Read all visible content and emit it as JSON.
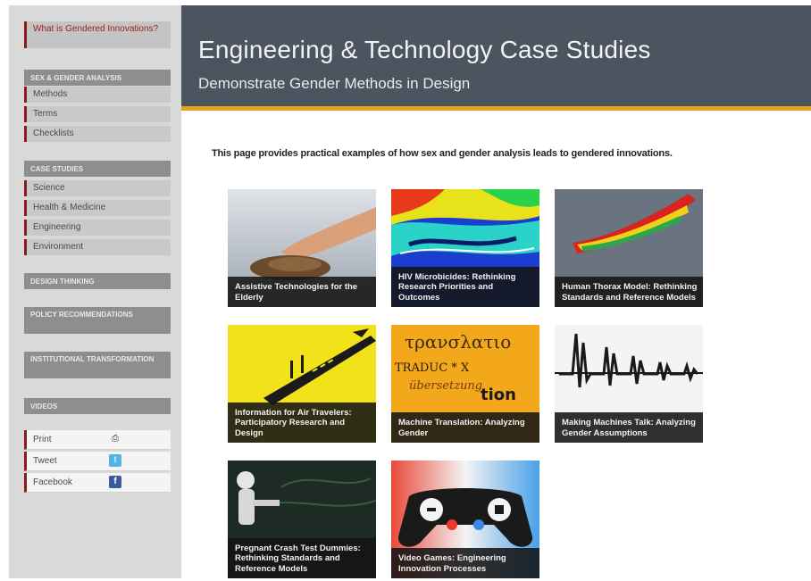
{
  "sidebar": {
    "intro_link": "What is Gendered Innovations?",
    "sections": {
      "sex_gender": "Sex & Gender Analysis",
      "case_studies": "Case Studies",
      "design_thinking": "Design Thinking",
      "policy": "Policy Recommendations",
      "institutional": "Institutional Transformation",
      "videos": "Videos"
    },
    "methods_items": [
      "Methods",
      "Terms",
      "Checklists"
    ],
    "case_items": [
      "Science",
      "Health & Medicine",
      "Engineering",
      "Environment"
    ],
    "share": [
      {
        "label": "Print",
        "icon": "printer-icon"
      },
      {
        "label": "Tweet",
        "icon": "twitter-icon"
      },
      {
        "label": "Facebook",
        "icon": "facebook-icon"
      }
    ]
  },
  "header": {
    "title": "Engineering & Technology Case Studies",
    "subtitle": "Demonstrate Gender Methods in Design",
    "accent_color": "#e8a21e"
  },
  "main": {
    "intro": "This page provides practical examples of how sex and gender analysis leads to gendered innovations.",
    "cards": [
      {
        "caption": "Assistive Technologies for the Elderly"
      },
      {
        "caption": "HIV Microbicides: Rethinking Research Priorities and Outcomes"
      },
      {
        "caption": "Human Thorax Model: Rethinking Standards and Reference Models"
      },
      {
        "caption": "Information for Air Travelers: Participatory Research and Design"
      },
      {
        "caption": "Machine Translation: Analyzing Gender"
      },
      {
        "caption": "Making Machines Talk: Analyzing Gender Assumptions"
      },
      {
        "caption": "Pregnant Crash Test Dummies: Rethinking Standards and Reference Models"
      },
      {
        "caption": "Video Games: Engineering Innovation Processes"
      }
    ]
  }
}
